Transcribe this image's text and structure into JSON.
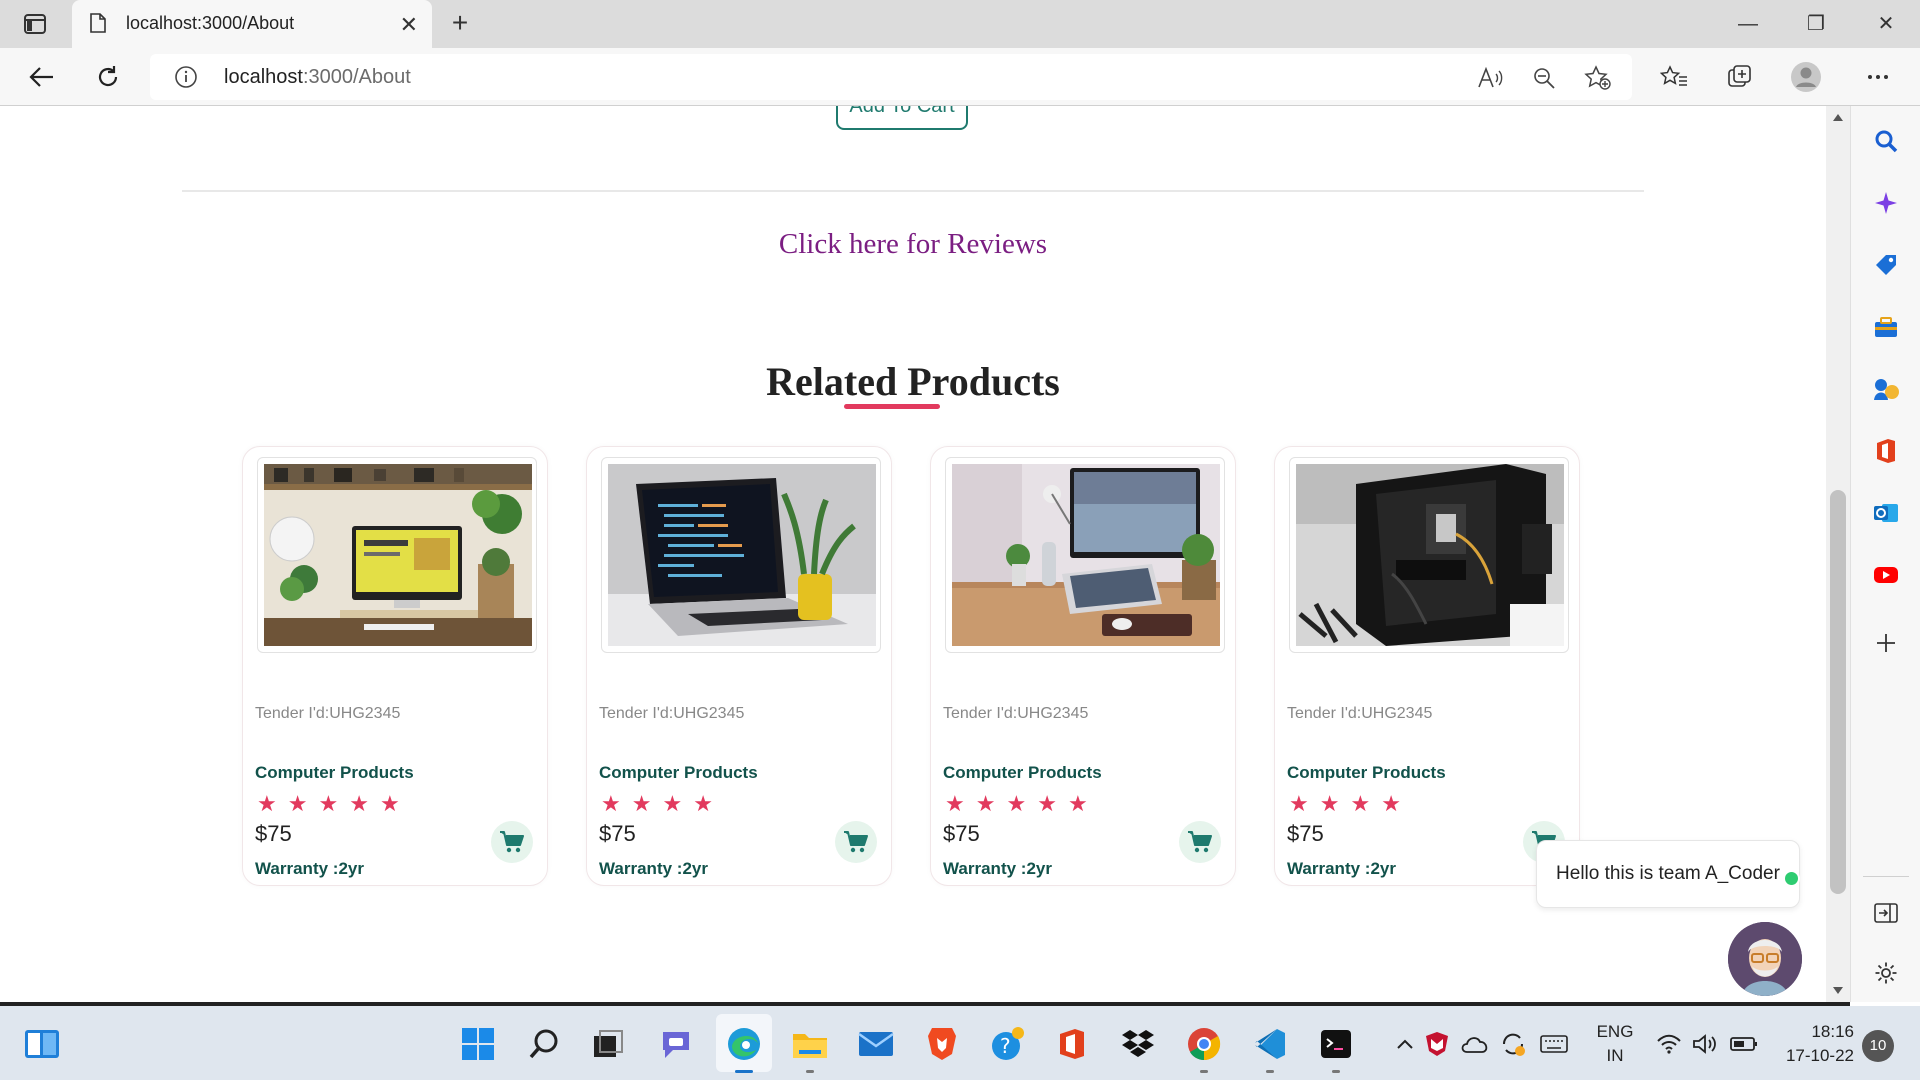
{
  "browser": {
    "tab_title": "localhost:3000/About",
    "url_host": "localhost",
    "url_rest": ":3000/About"
  },
  "page": {
    "add_to_cart_partial": "Add To Cart",
    "reviews_link": "Click here for Reviews",
    "related_title": "Related Products",
    "products": [
      {
        "tender": "Tender I'd:UHG2345",
        "category": "Computer Products",
        "rating": 5,
        "price": "$75",
        "warranty": "Warranty :2yr",
        "image": "desk-monitor-plants"
      },
      {
        "tender": "Tender I'd:UHG2345",
        "category": "Computer Products",
        "rating": 4,
        "price": "$75",
        "warranty": "Warranty :2yr",
        "image": "laptop-code"
      },
      {
        "tender": "Tender I'd:UHG2345",
        "category": "Computer Products",
        "rating": 5,
        "price": "$75",
        "warranty": "Warranty :2yr",
        "image": "desk-laptop-monitor"
      },
      {
        "tender": "Tender I'd:UHG2345",
        "category": "Computer Products",
        "rating": 4,
        "price": "$75",
        "warranty": "Warranty :2yr",
        "image": "pc-case"
      }
    ],
    "chat_message": "Hello this is team A_Coder"
  },
  "taskbar": {
    "language": "ENG",
    "region": "IN",
    "time": "18:16",
    "date": "17-10-22",
    "notifications": "10"
  },
  "colors": {
    "accent_teal": "#1f7a6e",
    "star": "#e23a5e",
    "link_purple": "#7b1e82"
  }
}
